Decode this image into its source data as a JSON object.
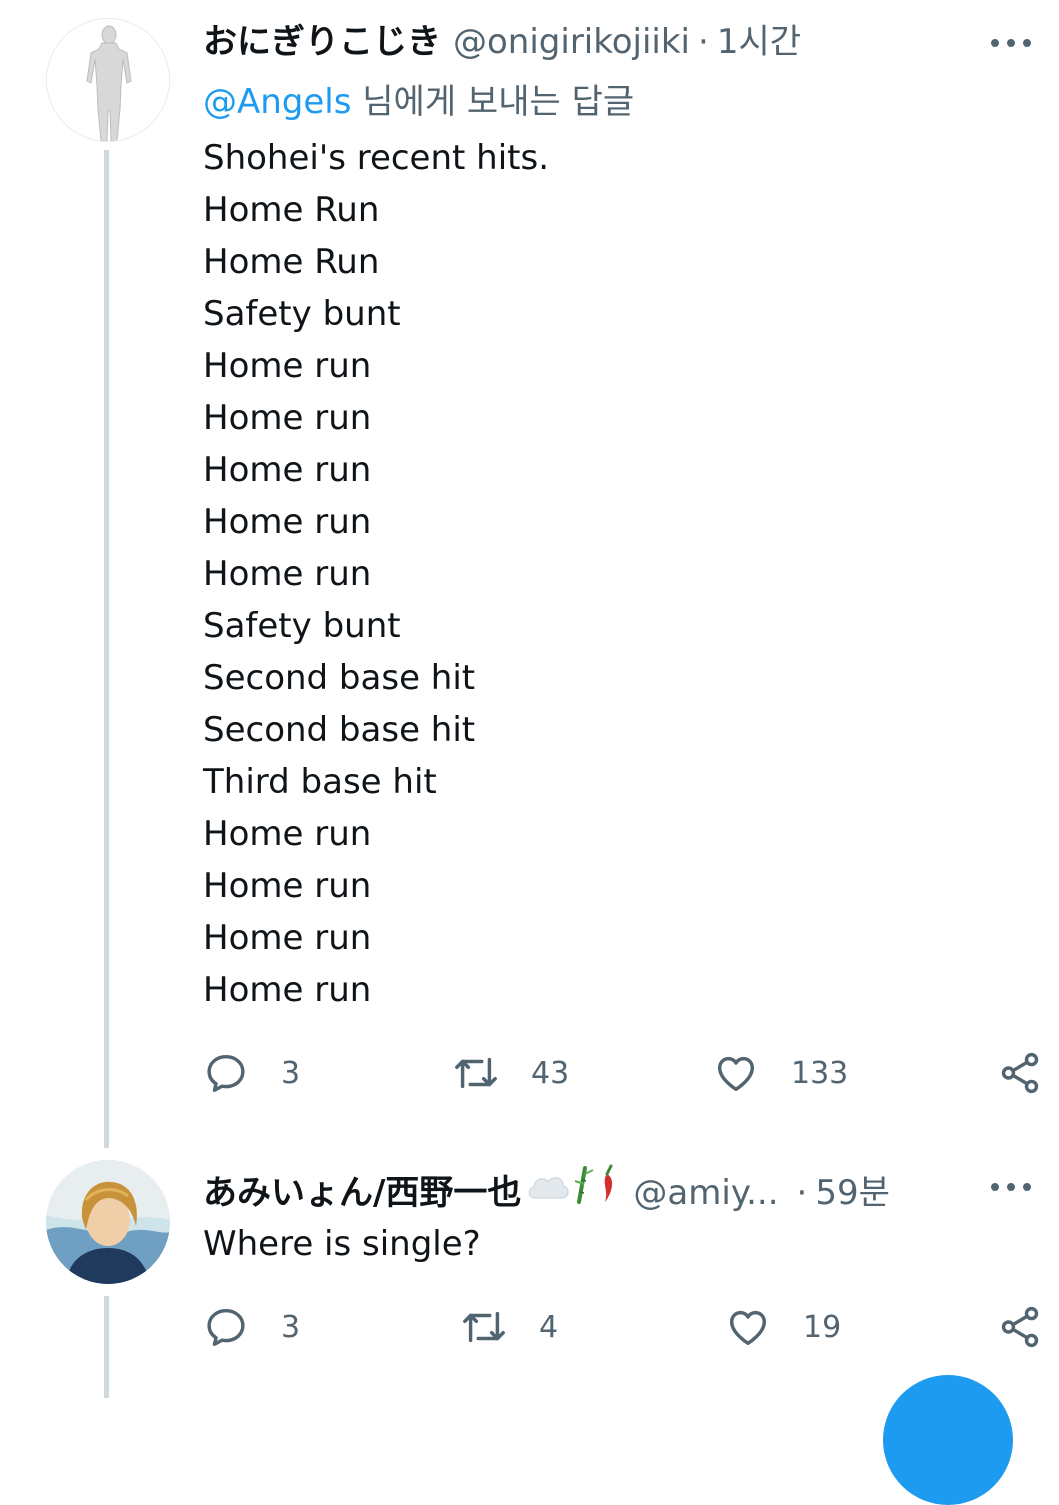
{
  "tweet1": {
    "display_name": "おにぎりこじき",
    "handle": "@onigirikojiiki",
    "separator": "·",
    "time": "1시간",
    "reply_prefix": "@Angels",
    "reply_suffix": " 님에게 보내는 답글",
    "lines": [
      "Shohei's recent hits.",
      "Home Run",
      "Home Run",
      "Safety bunt",
      "Home run",
      "Home run",
      "Home run",
      "Home run",
      "Home run",
      "Safety bunt",
      "Second base hit",
      "Second base hit",
      "Third base hit",
      "Home run",
      "Home run",
      "Home run",
      "Home run"
    ],
    "replies": "3",
    "retweets": "43",
    "likes": "133"
  },
  "tweet2": {
    "display_name": "あみいょん/西野一也",
    "handle": "@amiy...",
    "separator": "·",
    "time": "59분",
    "text": "Where is single?",
    "replies": "3",
    "retweets": "4",
    "likes": "19"
  },
  "icons": {
    "reply": "reply-icon",
    "retweet": "retweet-icon",
    "like": "heart-icon",
    "share": "share-icon",
    "more": "more-icon",
    "cloud_emoji": "cloud-emoji",
    "bamboo_emoji": "bamboo-emoji",
    "pepper_emoji": "chili-pepper-emoji"
  },
  "colors": {
    "accent": "#1d9bf0",
    "secondary_text": "#536471",
    "thread_line": "#cfd9de"
  }
}
